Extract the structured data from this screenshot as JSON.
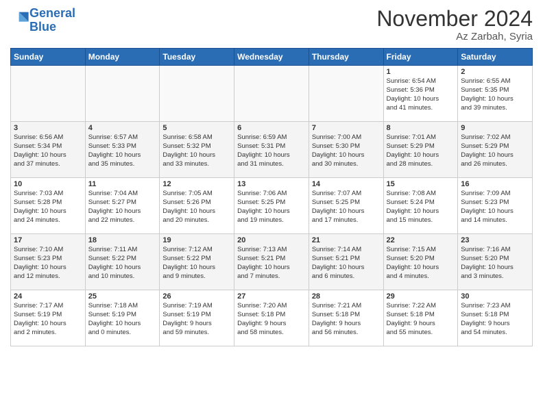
{
  "header": {
    "logo_line1": "General",
    "logo_line2": "Blue",
    "month": "November 2024",
    "location": "Az Zarbah, Syria"
  },
  "weekdays": [
    "Sunday",
    "Monday",
    "Tuesday",
    "Wednesday",
    "Thursday",
    "Friday",
    "Saturday"
  ],
  "weeks": [
    [
      {
        "day": "",
        "info": ""
      },
      {
        "day": "",
        "info": ""
      },
      {
        "day": "",
        "info": ""
      },
      {
        "day": "",
        "info": ""
      },
      {
        "day": "",
        "info": ""
      },
      {
        "day": "1",
        "info": "Sunrise: 6:54 AM\nSunset: 5:36 PM\nDaylight: 10 hours\nand 41 minutes."
      },
      {
        "day": "2",
        "info": "Sunrise: 6:55 AM\nSunset: 5:35 PM\nDaylight: 10 hours\nand 39 minutes."
      }
    ],
    [
      {
        "day": "3",
        "info": "Sunrise: 6:56 AM\nSunset: 5:34 PM\nDaylight: 10 hours\nand 37 minutes."
      },
      {
        "day": "4",
        "info": "Sunrise: 6:57 AM\nSunset: 5:33 PM\nDaylight: 10 hours\nand 35 minutes."
      },
      {
        "day": "5",
        "info": "Sunrise: 6:58 AM\nSunset: 5:32 PM\nDaylight: 10 hours\nand 33 minutes."
      },
      {
        "day": "6",
        "info": "Sunrise: 6:59 AM\nSunset: 5:31 PM\nDaylight: 10 hours\nand 31 minutes."
      },
      {
        "day": "7",
        "info": "Sunrise: 7:00 AM\nSunset: 5:30 PM\nDaylight: 10 hours\nand 30 minutes."
      },
      {
        "day": "8",
        "info": "Sunrise: 7:01 AM\nSunset: 5:29 PM\nDaylight: 10 hours\nand 28 minutes."
      },
      {
        "day": "9",
        "info": "Sunrise: 7:02 AM\nSunset: 5:29 PM\nDaylight: 10 hours\nand 26 minutes."
      }
    ],
    [
      {
        "day": "10",
        "info": "Sunrise: 7:03 AM\nSunset: 5:28 PM\nDaylight: 10 hours\nand 24 minutes."
      },
      {
        "day": "11",
        "info": "Sunrise: 7:04 AM\nSunset: 5:27 PM\nDaylight: 10 hours\nand 22 minutes."
      },
      {
        "day": "12",
        "info": "Sunrise: 7:05 AM\nSunset: 5:26 PM\nDaylight: 10 hours\nand 20 minutes."
      },
      {
        "day": "13",
        "info": "Sunrise: 7:06 AM\nSunset: 5:25 PM\nDaylight: 10 hours\nand 19 minutes."
      },
      {
        "day": "14",
        "info": "Sunrise: 7:07 AM\nSunset: 5:25 PM\nDaylight: 10 hours\nand 17 minutes."
      },
      {
        "day": "15",
        "info": "Sunrise: 7:08 AM\nSunset: 5:24 PM\nDaylight: 10 hours\nand 15 minutes."
      },
      {
        "day": "16",
        "info": "Sunrise: 7:09 AM\nSunset: 5:23 PM\nDaylight: 10 hours\nand 14 minutes."
      }
    ],
    [
      {
        "day": "17",
        "info": "Sunrise: 7:10 AM\nSunset: 5:23 PM\nDaylight: 10 hours\nand 12 minutes."
      },
      {
        "day": "18",
        "info": "Sunrise: 7:11 AM\nSunset: 5:22 PM\nDaylight: 10 hours\nand 10 minutes."
      },
      {
        "day": "19",
        "info": "Sunrise: 7:12 AM\nSunset: 5:22 PM\nDaylight: 10 hours\nand 9 minutes."
      },
      {
        "day": "20",
        "info": "Sunrise: 7:13 AM\nSunset: 5:21 PM\nDaylight: 10 hours\nand 7 minutes."
      },
      {
        "day": "21",
        "info": "Sunrise: 7:14 AM\nSunset: 5:21 PM\nDaylight: 10 hours\nand 6 minutes."
      },
      {
        "day": "22",
        "info": "Sunrise: 7:15 AM\nSunset: 5:20 PM\nDaylight: 10 hours\nand 4 minutes."
      },
      {
        "day": "23",
        "info": "Sunrise: 7:16 AM\nSunset: 5:20 PM\nDaylight: 10 hours\nand 3 minutes."
      }
    ],
    [
      {
        "day": "24",
        "info": "Sunrise: 7:17 AM\nSunset: 5:19 PM\nDaylight: 10 hours\nand 2 minutes."
      },
      {
        "day": "25",
        "info": "Sunrise: 7:18 AM\nSunset: 5:19 PM\nDaylight: 10 hours\nand 0 minutes."
      },
      {
        "day": "26",
        "info": "Sunrise: 7:19 AM\nSunset: 5:19 PM\nDaylight: 9 hours\nand 59 minutes."
      },
      {
        "day": "27",
        "info": "Sunrise: 7:20 AM\nSunset: 5:18 PM\nDaylight: 9 hours\nand 58 minutes."
      },
      {
        "day": "28",
        "info": "Sunrise: 7:21 AM\nSunset: 5:18 PM\nDaylight: 9 hours\nand 56 minutes."
      },
      {
        "day": "29",
        "info": "Sunrise: 7:22 AM\nSunset: 5:18 PM\nDaylight: 9 hours\nand 55 minutes."
      },
      {
        "day": "30",
        "info": "Sunrise: 7:23 AM\nSunset: 5:18 PM\nDaylight: 9 hours\nand 54 minutes."
      }
    ]
  ]
}
